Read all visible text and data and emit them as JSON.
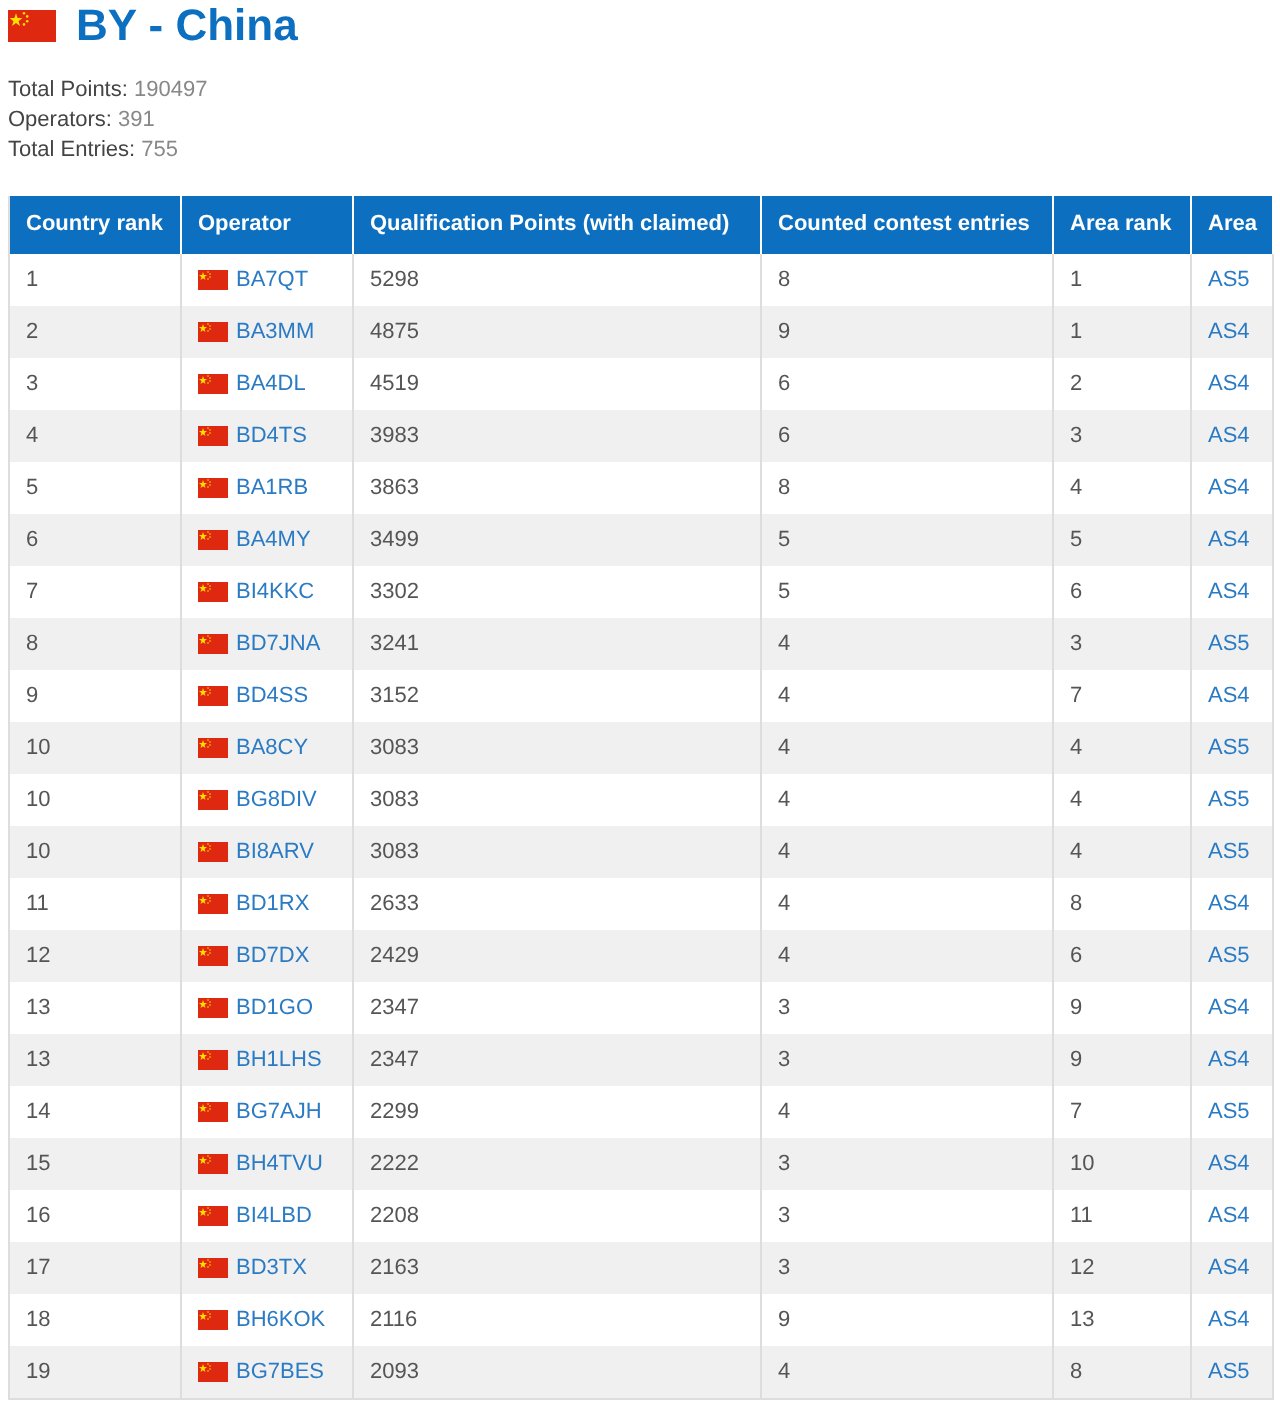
{
  "title": "BY - China",
  "stats": [
    {
      "label": "Total Points:",
      "value": "190497"
    },
    {
      "label": "Operators:",
      "value": "391"
    },
    {
      "label": "Total Entries:",
      "value": "755"
    }
  ],
  "table": {
    "columns": [
      "Country rank",
      "Operator",
      "Qualification Points (with claimed)",
      "Counted contest entries",
      "Area rank",
      "Area"
    ],
    "rows": [
      {
        "rank": "1",
        "operator": "BA7QT",
        "points": "5298",
        "entries": "8",
        "area_rank": "1",
        "area": "AS5"
      },
      {
        "rank": "2",
        "operator": "BA3MM",
        "points": "4875",
        "entries": "9",
        "area_rank": "1",
        "area": "AS4"
      },
      {
        "rank": "3",
        "operator": "BA4DL",
        "points": "4519",
        "entries": "6",
        "area_rank": "2",
        "area": "AS4"
      },
      {
        "rank": "4",
        "operator": "BD4TS",
        "points": "3983",
        "entries": "6",
        "area_rank": "3",
        "area": "AS4"
      },
      {
        "rank": "5",
        "operator": "BA1RB",
        "points": "3863",
        "entries": "8",
        "area_rank": "4",
        "area": "AS4"
      },
      {
        "rank": "6",
        "operator": "BA4MY",
        "points": "3499",
        "entries": "5",
        "area_rank": "5",
        "area": "AS4"
      },
      {
        "rank": "7",
        "operator": "BI4KKC",
        "points": "3302",
        "entries": "5",
        "area_rank": "6",
        "area": "AS4"
      },
      {
        "rank": "8",
        "operator": "BD7JNA",
        "points": "3241",
        "entries": "4",
        "area_rank": "3",
        "area": "AS5"
      },
      {
        "rank": "9",
        "operator": "BD4SS",
        "points": "3152",
        "entries": "4",
        "area_rank": "7",
        "area": "AS4"
      },
      {
        "rank": "10",
        "operator": "BA8CY",
        "points": "3083",
        "entries": "4",
        "area_rank": "4",
        "area": "AS5"
      },
      {
        "rank": "10",
        "operator": "BG8DIV",
        "points": "3083",
        "entries": "4",
        "area_rank": "4",
        "area": "AS5"
      },
      {
        "rank": "10",
        "operator": "BI8ARV",
        "points": "3083",
        "entries": "4",
        "area_rank": "4",
        "area": "AS5"
      },
      {
        "rank": "11",
        "operator": "BD1RX",
        "points": "2633",
        "entries": "4",
        "area_rank": "8",
        "area": "AS4"
      },
      {
        "rank": "12",
        "operator": "BD7DX",
        "points": "2429",
        "entries": "4",
        "area_rank": "6",
        "area": "AS5"
      },
      {
        "rank": "13",
        "operator": "BD1GO",
        "points": "2347",
        "entries": "3",
        "area_rank": "9",
        "area": "AS4"
      },
      {
        "rank": "13",
        "operator": "BH1LHS",
        "points": "2347",
        "entries": "3",
        "area_rank": "9",
        "area": "AS4"
      },
      {
        "rank": "14",
        "operator": "BG7AJH",
        "points": "2299",
        "entries": "4",
        "area_rank": "7",
        "area": "AS5"
      },
      {
        "rank": "15",
        "operator": "BH4TVU",
        "points": "2222",
        "entries": "3",
        "area_rank": "10",
        "area": "AS4"
      },
      {
        "rank": "16",
        "operator": "BI4LBD",
        "points": "2208",
        "entries": "3",
        "area_rank": "11",
        "area": "AS4"
      },
      {
        "rank": "17",
        "operator": "BD3TX",
        "points": "2163",
        "entries": "3",
        "area_rank": "12",
        "area": "AS4"
      },
      {
        "rank": "18",
        "operator": "BH6KOK",
        "points": "2116",
        "entries": "9",
        "area_rank": "13",
        "area": "AS4"
      },
      {
        "rank": "19",
        "operator": "BG7BES",
        "points": "2093",
        "entries": "4",
        "area_rank": "8",
        "area": "AS5"
      }
    ]
  }
}
